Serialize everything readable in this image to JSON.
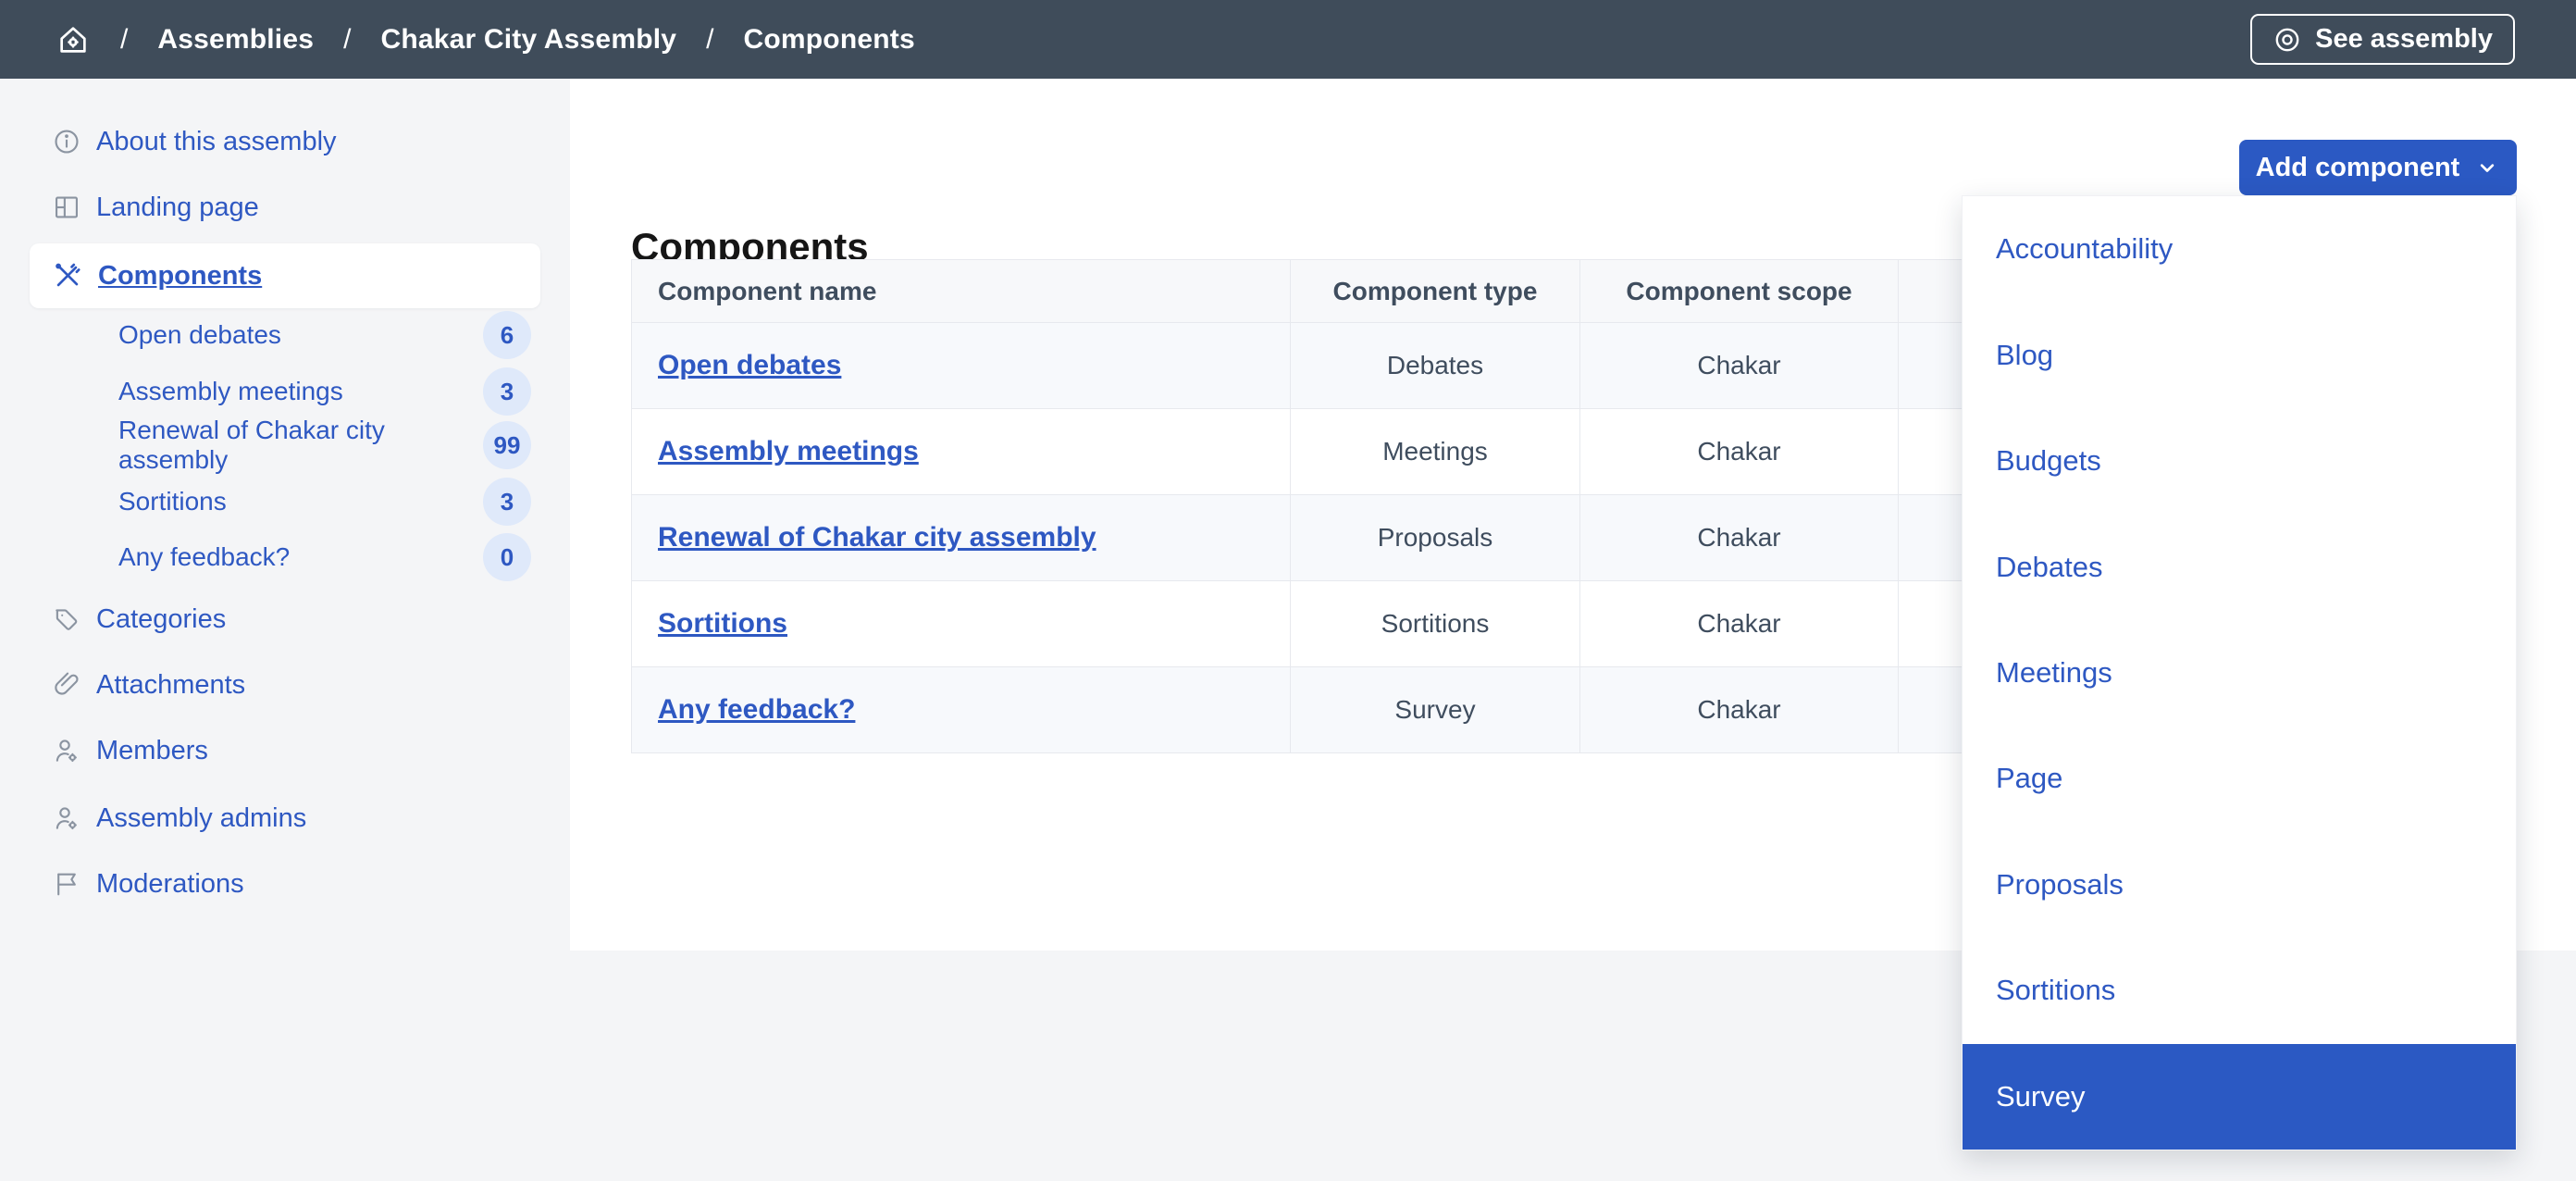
{
  "topbar": {
    "separator": "/",
    "breadcrumb": [
      {
        "label": "Assemblies"
      },
      {
        "label": "Chakar City Assembly"
      },
      {
        "label": "Components"
      }
    ],
    "see_assembly_label": "See assembly"
  },
  "sidebar": {
    "top_items": [
      {
        "label": "About this assembly"
      },
      {
        "label": "Landing page"
      },
      {
        "label": "Components"
      }
    ],
    "components_children": [
      {
        "label": "Open debates",
        "count": "6"
      },
      {
        "label": "Assembly meetings",
        "count": "3"
      },
      {
        "label": "Renewal of Chakar city assembly",
        "count": "99"
      },
      {
        "label": "Sortitions",
        "count": "3"
      },
      {
        "label": "Any feedback?",
        "count": "0"
      }
    ],
    "bottom_items": [
      {
        "label": "Categories"
      },
      {
        "label": "Attachments"
      },
      {
        "label": "Members"
      },
      {
        "label": "Assembly admins"
      },
      {
        "label": "Moderations"
      }
    ]
  },
  "main": {
    "title": "Components",
    "add_component_label": "Add component",
    "table": {
      "columns": [
        "Component name",
        "Component type",
        "Component scope"
      ],
      "rows": [
        {
          "name": "Open debates",
          "type": "Debates",
          "scope": "Chakar"
        },
        {
          "name": "Assembly meetings",
          "type": "Meetings",
          "scope": "Chakar"
        },
        {
          "name": "Renewal of Chakar city assembly",
          "type": "Proposals",
          "scope": "Chakar"
        },
        {
          "name": "Sortitions",
          "type": "Sortitions",
          "scope": "Chakar"
        },
        {
          "name": "Any feedback?",
          "type": "Survey",
          "scope": "Chakar"
        }
      ]
    },
    "dropdown": {
      "items": [
        "Accountability",
        "Blog",
        "Budgets",
        "Debates",
        "Meetings",
        "Page",
        "Proposals",
        "Sortitions",
        "Survey"
      ],
      "selected": "Survey"
    }
  },
  "colors": {
    "topbar_bg": "#3f4c5a",
    "primary": "#2b59c3",
    "link": "#2e58c2",
    "page_bg": "#f4f5f7",
    "badge_bg": "#dfe9fa",
    "table_header_bg": "#f7f8fa",
    "row_alt_bg": "#f7f9fc",
    "border": "#e7e9ee",
    "icon_gray": "#8b94a1",
    "heading_text": "#161616",
    "cell_text": "#3f4d5e"
  }
}
